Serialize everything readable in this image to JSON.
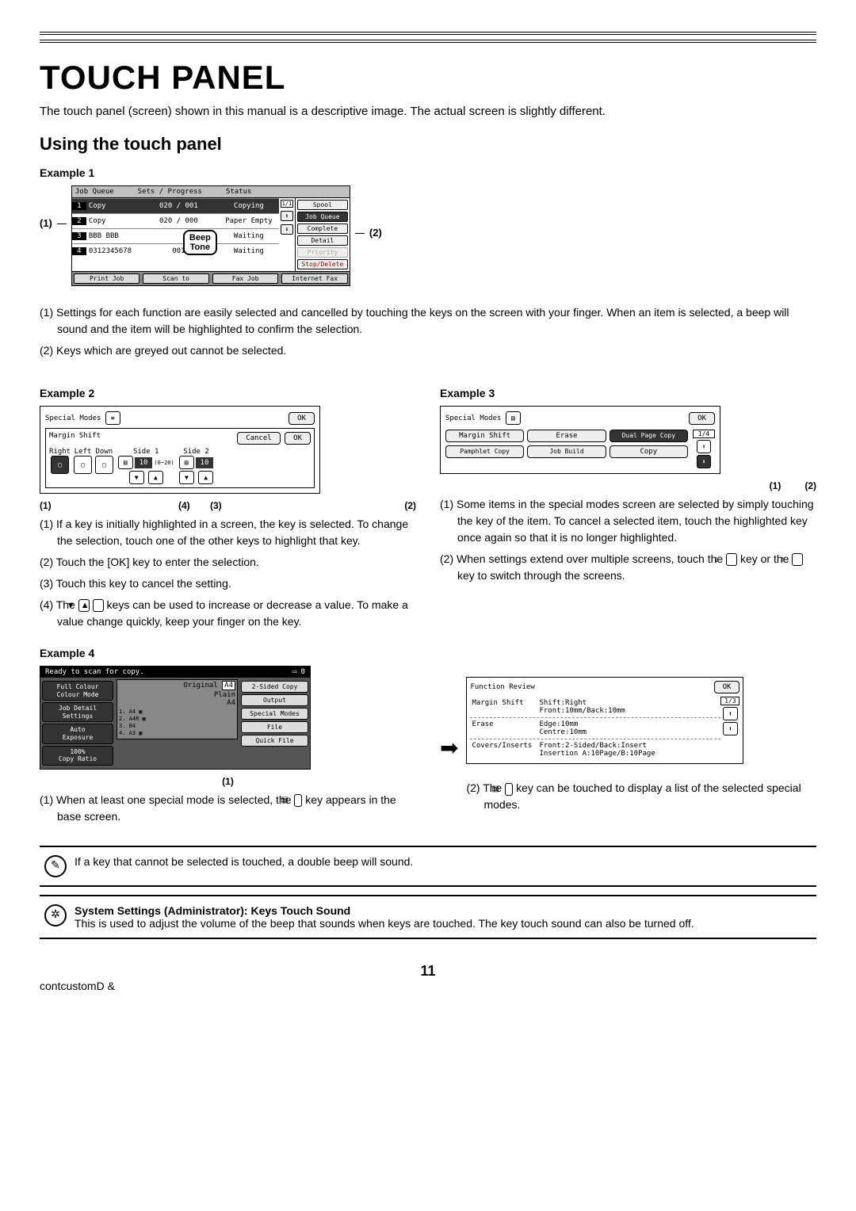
{
  "page": {
    "title": "TOUCH PANEL",
    "intro": "The touch panel (screen) shown in this manual is a descriptive image. The actual screen is slightly different.",
    "subheading": "Using the touch panel",
    "pagenum": "11"
  },
  "ex1": {
    "label": "Example 1",
    "c1": "(1)",
    "c2": "(2)",
    "headers": {
      "jobqueue": "Job Queue",
      "sets": "Sets / Progress",
      "status": "Status"
    },
    "rows": [
      {
        "n": "1",
        "name": "Copy",
        "sets": "020 / 001",
        "status": "Copying"
      },
      {
        "n": "2",
        "name": "Copy",
        "sets": "020 / 000",
        "status": "Paper Empty"
      },
      {
        "n": "3",
        "name": "BBB BBB",
        "sets": "",
        "status": "Waiting"
      },
      {
        "n": "4",
        "name": "0312345678",
        "sets": "001",
        "status": "Waiting"
      }
    ],
    "page": "1/1",
    "side": {
      "spool": "Spool",
      "jobqueue": "Job Queue",
      "complete": "Complete",
      "detail": "Detail",
      "priority": "Priority",
      "stopdel": "Stop/Delete"
    },
    "bottom": {
      "print": "Print Job",
      "scan": "Scan to",
      "fax": "Fax Job",
      "ifax": "Internet Fax"
    },
    "beep": "Beep\nTone",
    "note1": "(1) Settings for each function are easily selected and cancelled by touching the keys on the screen with your finger. When an item is selected, a beep will sound and the item will be highlighted to confirm the selection.",
    "note2": "(2) Keys which are greyed out cannot be selected."
  },
  "ex2": {
    "label": "Example 2",
    "sm": "Special Modes",
    "ok": "OK",
    "ms": "Margin Shift",
    "cancel": "Cancel",
    "ok2": "OK",
    "right": "Right",
    "left": "Left",
    "down": "Down",
    "side1": "Side 1",
    "side2": "Side 2",
    "val": "10",
    "range": "(0~20)",
    "m1": "(1)",
    "m2": "(2)",
    "m3": "(3)",
    "m4": "(4)",
    "t1": "(1) If a key is initially highlighted in a screen, the key is selected. To change the selection, touch one of the other keys to highlight that key.",
    "t2": "(2) Touch the [OK] key to enter the selection.",
    "t3": "(3) Touch this key to cancel the setting.",
    "t4a": "(4) The ",
    "t4b": " keys can be used to increase or decrease a value. To make a value change quickly, keep your finger on the key."
  },
  "ex3": {
    "label": "Example 3",
    "sm": "Special Modes",
    "ok": "OK",
    "page": "1/4",
    "margin": "Margin Shift",
    "erase": "Erase",
    "dual": "Dual Page Copy",
    "pamphlet": "Pamphlet Copy",
    "job": "Job Build",
    "copy": "Copy",
    "m1": "(1)",
    "m2": "(2)",
    "t1": "(1) Some items in the special modes screen are selected by simply touching the key of the item. To cancel a selected item, touch the highlighted key once again so that it is no longer highlighted.",
    "t2a": "(2) When settings extend over multiple screens, touch the ",
    "t2b": " key or the ",
    "t2c": " key to switch through the screens."
  },
  "ex4": {
    "label": "Example 4",
    "ready": "Ready to scan for copy.",
    "zero": "0",
    "fc": "Full Colour",
    "cm": "Colour Mode",
    "orig": "Original",
    "a4": "A4",
    "plain": "Plain",
    "a4b": "A4",
    "tray": [
      "A4",
      "A4R",
      "B4",
      "A3"
    ],
    "jds": "Job Detail Settings",
    "auto": "Auto",
    "exp": "Exposure",
    "p100": "100%",
    "cr": "Copy Ratio",
    "twosided": "2-Sided Copy",
    "output": "Output",
    "sm": "Special Modes",
    "file": "File",
    "qf": "Quick File",
    "m1": "(1)",
    "t1a": "(1) When at least one special mode is selected, the ",
    "t1b": " key appears in the base screen.",
    "t2a": "(2) The ",
    "t2b": " key can be touched to display a list of the selected special modes.",
    "fr": "Function Review",
    "ok": "OK",
    "page": "1/3",
    "rows": [
      {
        "l": "Margin Shift",
        "m": "Shift:Right\nFront:10mm/Back:10mm"
      },
      {
        "l": "Erase",
        "m": "Edge:10mm\nCentre:10mm"
      },
      {
        "l": "Covers/Inserts",
        "m": "Front:2-Sided/Back:Insert\nInsertion A:10Page/B:10Page"
      }
    ]
  },
  "notes": {
    "n1": "If a key that cannot be selected is touched, a double beep will sound.",
    "syshead": "System Settings (Administrator): Keys Touch Sound",
    "sysbody": "This is used to adjust the volume of the beep that sounds when keys are touched. The key touch sound can also be turned off."
  }
}
